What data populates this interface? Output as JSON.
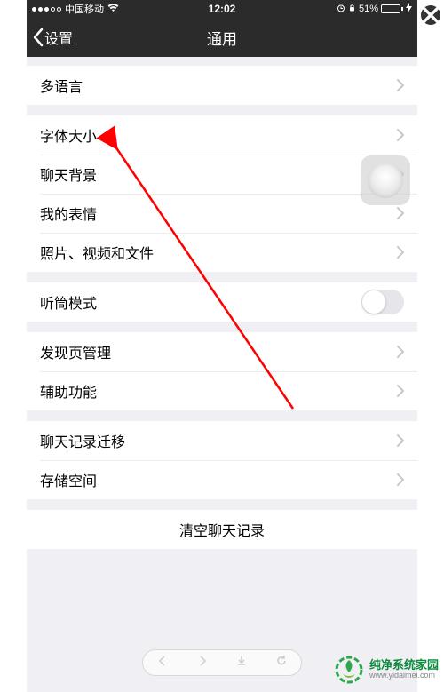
{
  "status": {
    "carrier": "中国移动",
    "time": "12:02",
    "battery_percent": "51%"
  },
  "nav": {
    "back_label": "设置",
    "title": "通用"
  },
  "groups": {
    "g1": {
      "lang": "多语言"
    },
    "g2": {
      "font": "字体大小",
      "bg": "聊天背景",
      "sticker": "我的表情",
      "media": "照片、视频和文件"
    },
    "g3": {
      "receiver": "听筒模式"
    },
    "g4": {
      "discover": "发现页管理",
      "assist": "辅助功能"
    },
    "g5": {
      "migrate": "聊天记录迁移",
      "storage": "存储空间"
    },
    "g6": {
      "clear": "清空聊天记录"
    }
  },
  "watermark": {
    "title": "纯净系统家园",
    "url": "www.yidaimei.com"
  }
}
